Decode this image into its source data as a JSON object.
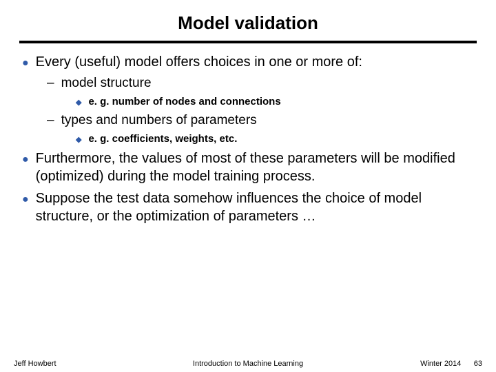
{
  "title": "Model validation",
  "bullets": {
    "b1": "Every (useful) model offers choices in one or more of:",
    "b1_1": "model structure",
    "b1_1_1": "e. g. number of nodes and connections",
    "b1_2": "types and numbers of parameters",
    "b1_2_1": "e. g. coefficients, weights, etc.",
    "b2": "Furthermore, the values of most of these parameters will be modified (optimized) during the model training process.",
    "b3": "Suppose the test data somehow influences the choice of model structure, or the optimization of parameters …"
  },
  "footer": {
    "left": "Jeff Howbert",
    "center": "Introduction to Machine Learning",
    "right_term": "Winter 2014",
    "right_page": "63"
  }
}
